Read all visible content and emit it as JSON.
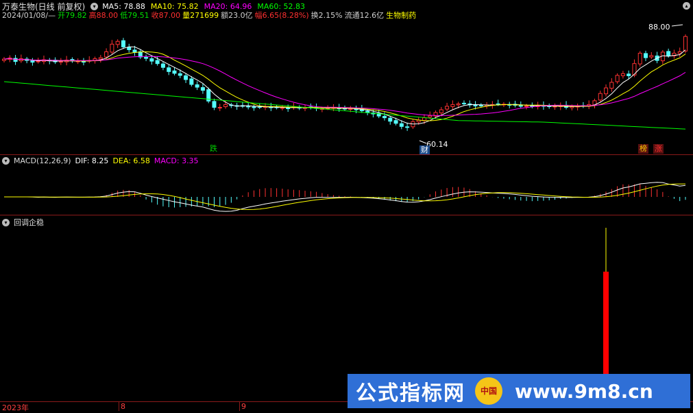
{
  "header": {
    "stock": "万泰生物(日线 前复权)",
    "ma": [
      {
        "label": "MA5: 78.88",
        "color": "#ffffff"
      },
      {
        "label": "MA10: 75.82",
        "color": "#ffff00"
      },
      {
        "label": "MA20: 64.96",
        "color": "#ff00ff"
      },
      {
        "label": "MA60: 52.83",
        "color": "#00ff00"
      }
    ],
    "info": [
      {
        "label": "2024/01/08/—",
        "color": "#d0d0d0"
      },
      {
        "label": "开79.82",
        "color": "#00e000"
      },
      {
        "label": "高88.00",
        "color": "#ff3030"
      },
      {
        "label": "低79.51",
        "color": "#00e000"
      },
      {
        "label": "收87.00",
        "color": "#ff3030"
      },
      {
        "label": "量271699",
        "color": "#ffff00"
      },
      {
        "label": "额23.0亿",
        "color": "#d0d0d0"
      },
      {
        "label": "幅6.65(8.28%)",
        "color": "#ff3030"
      },
      {
        "label": "换2.15%",
        "color": "#d0d0d0"
      },
      {
        "label": "流通12.6亿",
        "color": "#d0d0d0"
      },
      {
        "label": "生物制药",
        "color": "#ffff00"
      }
    ]
  },
  "price_panel": {
    "high_label": "88.00",
    "low_label": "60.14",
    "tags": [
      {
        "text": "跌",
        "color": "#00d000",
        "bg": "#000"
      },
      {
        "text": "财",
        "color": "#ffffff",
        "bg": "#1a4a8a"
      },
      {
        "text": "榜",
        "color": "#ffcc00",
        "bg": "#5a1010"
      },
      {
        "text": "涨",
        "color": "#ff3030",
        "bg": "#5a1010"
      }
    ]
  },
  "macd_panel": {
    "title": "MACD(12,26,9)",
    "dif": "DIF: 8.25",
    "dea": "DEA: 6.58",
    "macd": "MACD: 3.35"
  },
  "indicator_panel": {
    "title": "回调企稳"
  },
  "x_axis": {
    "labels": [
      "2023年",
      "8",
      "9"
    ]
  },
  "watermark": {
    "text": "公式指标网",
    "url": "www.9m8.cn",
    "badge": "中国"
  },
  "chart_data": {
    "type": "candlestick",
    "ma_colors": {
      "ma5": "#ffffff",
      "ma10": "#ffff00",
      "ma20": "#ff00ff",
      "ma60": "#00ff00"
    },
    "closes": [
      80.5,
      80.8,
      79.8,
      80.6,
      80.1,
      79.6,
      79.9,
      80.3,
      80.0,
      79.7,
      79.8,
      80.2,
      80.0,
      79.9,
      79.7,
      80.1,
      80.6,
      80.9,
      82.6,
      84.8,
      85.6,
      84.0,
      83.2,
      82.4,
      81.1,
      80.7,
      79.9,
      79.2,
      78.1,
      76.9,
      76.4,
      75.8,
      74.6,
      73.2,
      72.4,
      71.5,
      68.4,
      66.6,
      66.6,
      67.4,
      67.2,
      66.9,
      67.0,
      66.8,
      66.6,
      66.7,
      66.8,
      66.5,
      66.6,
      66.5,
      66.3,
      66.7,
      66.6,
      66.5,
      66.6,
      66.3,
      66.2,
      66.4,
      66.5,
      66.3,
      66.1,
      66.2,
      65.9,
      65.6,
      65.1,
      64.7,
      64.1,
      63.6,
      62.6,
      62.0,
      61.1,
      60.8,
      62.5,
      62.9,
      63.6,
      64.2,
      65.1,
      65.9,
      66.9,
      67.4,
      67.6,
      67.7,
      67.3,
      67.0,
      67.1,
      67.3,
      67.4,
      67.6,
      67.5,
      67.3,
      67.2,
      67.1,
      67.0,
      66.9,
      67.2,
      66.9,
      66.8,
      66.9,
      67.0,
      66.6,
      66.8,
      66.9,
      67.0,
      67.4,
      68.5,
      70.6,
      72.2,
      73.8,
      75.8,
      76.3,
      75.7,
      79.2,
      82.2,
      80.9,
      81.5,
      80.1,
      82.5,
      81.5,
      82.2,
      82.6,
      87.0
    ],
    "macd_hist_trend": "negative mid-2023, positive rising into 2024-01",
    "dif": 8.25,
    "dea": 6.58,
    "macd": 3.35,
    "indicator_last_value_signal": true
  }
}
